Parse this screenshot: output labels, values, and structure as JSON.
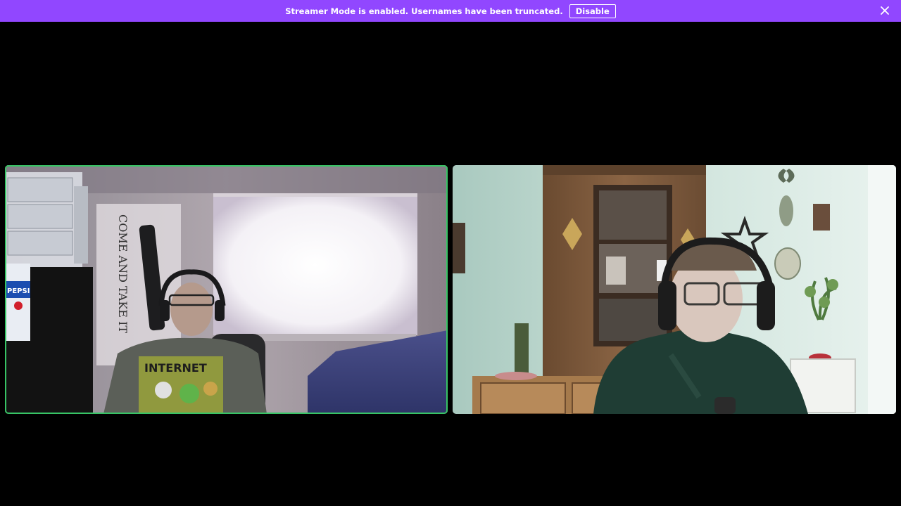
{
  "notice_bar": {
    "message": "Streamer Mode is enabled. Usernames have been truncated.",
    "disable_label": "Disable",
    "close_icon": "close-icon",
    "background": "#9147ff"
  },
  "video_grid": {
    "tiles": [
      {
        "id": "participant-1",
        "speaking": true,
        "ring_color": "#3ccf6a",
        "wall_poster_text": "COME AND TAKE IT",
        "shirt_text": "INTERNET",
        "cup_text": "PEPSI"
      },
      {
        "id": "participant-2",
        "speaking": false
      }
    ]
  }
}
